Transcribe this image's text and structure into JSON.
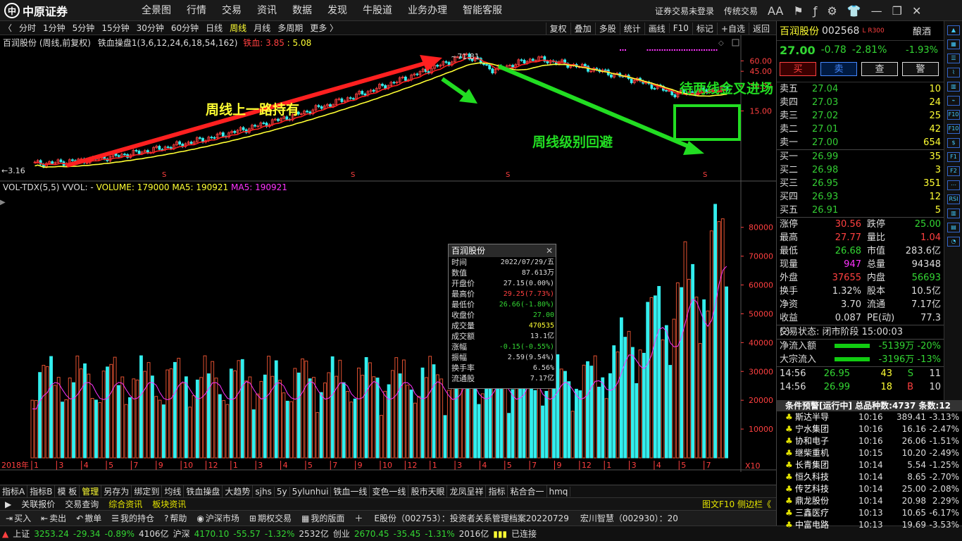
{
  "top_menu": {
    "logo_text": "中原证券",
    "logo_sub": "CENTRAL CHINA SECURITIES",
    "items": [
      "全景图",
      "行情",
      "交易",
      "资讯",
      "数据",
      "发现",
      "牛股道",
      "业务办理",
      "智能客服"
    ],
    "status": "证券交易未登录",
    "mode": "传统交易",
    "font_btn": "AA"
  },
  "period_bar": {
    "items": [
      "分时",
      "1分钟",
      "5分钟",
      "15分钟",
      "30分钟",
      "60分钟",
      "日线",
      "周线",
      "月线",
      "多周期",
      "更多 〉"
    ],
    "active": "周线",
    "right": [
      "复权",
      "叠加",
      "多股",
      "统计",
      "画线",
      "F10",
      "标记",
      "+自选",
      "返回"
    ]
  },
  "chart_info": {
    "title": "百润股份 (周线,前复权)",
    "indicator": "铁血操盘1(3,6,12,24,6,18,54,162)",
    "label_red": "铁血:",
    "val1": "3.85",
    "val2": "5.08",
    "price_high": "71.81",
    "price_low": "3.16"
  },
  "annotations": {
    "a1": "周线上一路持有",
    "a2": "周线级别回避",
    "a3": "待两线金叉进场"
  },
  "price_axis": [
    "60.00",
    "45.00",
    "30.00",
    "15.00"
  ],
  "vol_info": {
    "name": "VOL-TDX(5,5)",
    "vvol": "VVOL: -",
    "volume": "VOLUME: 179000",
    "ma5a": "MA5: 190921",
    "ma5b": "MA5: 190921"
  },
  "vol_axis": [
    "80000",
    "70000",
    "60000",
    "50000",
    "40000",
    "30000",
    "20000",
    "10000"
  ],
  "vol_unit": "X10",
  "time_axis": {
    "start": "2018年",
    "labels": [
      "1",
      "3",
      "4",
      "5",
      "7",
      "9",
      "10",
      "12",
      "1",
      "3",
      "4",
      "5",
      "7",
      "9",
      "10",
      "12",
      "1",
      "3",
      "4",
      "5",
      "7",
      "9",
      "12",
      "1",
      "3",
      "4",
      "5",
      "7"
    ],
    "period": "周线"
  },
  "popup": {
    "title": "百润股份",
    "rows": [
      {
        "l": "时间",
        "v": "2022/07/29/五",
        "c": "#ddd"
      },
      {
        "l": "数值",
        "v": "87.613万",
        "c": "#ddd"
      },
      {
        "l": "开盘价",
        "v": "27.15(0.00%)",
        "c": "#ddd"
      },
      {
        "l": "最高价",
        "v": "29.25(7.73%)",
        "c": "#ff4040"
      },
      {
        "l": "最低价",
        "v": "26.66(-1.80%)",
        "c": "#33d633"
      },
      {
        "l": "收盘价",
        "v": "27.00",
        "c": "#33d633"
      },
      {
        "l": "成交量",
        "v": "470535",
        "c": "#ffff33"
      },
      {
        "l": "成交额",
        "v": "13.1亿",
        "c": "#ddd"
      },
      {
        "l": "涨幅",
        "v": "-0.15(-0.55%)",
        "c": "#33d633"
      },
      {
        "l": "振幅",
        "v": "2.59(9.54%)",
        "c": "#ddd"
      },
      {
        "l": "换手率",
        "v": "6.56%",
        "c": "#ddd"
      },
      {
        "l": "流通股",
        "v": "7.17亿",
        "c": "#ddd"
      }
    ]
  },
  "bottom_tabs": {
    "items": [
      "指标A",
      "指标B",
      "模 板",
      "管理",
      "另存为",
      "绑定到",
      "均线",
      "铁血操盘",
      "大趋势",
      "sjhs",
      "5y",
      "5ylunhui",
      "铁血一线",
      "变色一线",
      "股市天眼",
      "龙凤呈祥",
      "指标",
      "粘合合一",
      "hmq"
    ],
    "active": "管理"
  },
  "info_bar": {
    "items": [
      "关联报价",
      "交易查询",
      "综合资讯",
      "板块资讯"
    ],
    "right": "图文F10 侧边栏《"
  },
  "tool_bar": {
    "items": [
      "买入",
      "卖出",
      "撤单",
      "我的持仓",
      "帮助",
      "沪深市场",
      "期权交易",
      "我的版面"
    ],
    "ticker": "E股份（002753）：投资者关系管理档案20220729",
    "ticker2": "宏川智慧（002930）：20"
  },
  "status_bar": {
    "sh": "上证",
    "sh_v": "3253.24",
    "sh_c": "-29.34",
    "sh_p": "-0.89%",
    "sh_a": "4106亿",
    "sz": "沪深",
    "sz_v": "4170.10",
    "sz_c": "-55.57",
    "sz_p": "-1.32%",
    "sz_a": "2532亿",
    "cy": "创业",
    "cy_v": "2670.45",
    "cy_c": "-35.45",
    "cy_p": "-1.31%",
    "cy_a": "2016亿",
    "conn": "已连接"
  },
  "stock": {
    "name": "百润股份",
    "code": "002568",
    "tags": "L R300",
    "sector": "酿酒",
    "price": "27.00",
    "chg": "-0.78",
    "pct": "-2.81%",
    "sector_pct": "-1.93%",
    "buttons": [
      "买",
      "卖",
      "查",
      "警"
    ]
  },
  "order_book": {
    "sell": [
      {
        "n": "卖五",
        "p": "27.04",
        "q": "10"
      },
      {
        "n": "卖四",
        "p": "27.03",
        "q": "24"
      },
      {
        "n": "卖三",
        "p": "27.02",
        "q": "25"
      },
      {
        "n": "卖二",
        "p": "27.01",
        "q": "42"
      },
      {
        "n": "卖一",
        "p": "27.00",
        "q": "654"
      }
    ],
    "buy": [
      {
        "n": "买一",
        "p": "26.99",
        "q": "35"
      },
      {
        "n": "买二",
        "p": "26.98",
        "q": "3"
      },
      {
        "n": "买三",
        "p": "26.95",
        "q": "351"
      },
      {
        "n": "买四",
        "p": "26.93",
        "q": "12"
      },
      {
        "n": "买五",
        "p": "26.91",
        "q": "5"
      }
    ]
  },
  "quote": [
    {
      "k": "涨停",
      "v": "30.56",
      "vc": "red",
      "k2": "跌停",
      "v2": "25.00",
      "v2c": "grn"
    },
    {
      "k": "最高",
      "v": "27.77",
      "vc": "red",
      "k2": "量比",
      "v2": "1.04",
      "v2c": "red"
    },
    {
      "k": "最低",
      "v": "26.68",
      "vc": "grn",
      "k2": "市值",
      "v2": "283.6亿",
      "v2c": "wht"
    },
    {
      "k": "现量",
      "v": "947",
      "vc": "mag",
      "k2": "总量",
      "v2": "94348",
      "v2c": "wht"
    },
    {
      "k": "外盘",
      "v": "37655",
      "vc": "red",
      "k2": "内盘",
      "v2": "56693",
      "v2c": "grn"
    },
    {
      "k": "换手",
      "v": "1.32%",
      "vc": "wht",
      "k2": "股本",
      "v2": "10.5亿",
      "v2c": "wht"
    },
    {
      "k": "净资",
      "v": "3.70",
      "vc": "wht",
      "k2": "流通",
      "v2": "7.17亿",
      "v2c": "wht"
    },
    {
      "k": "收益(-)",
      "v": "0.087",
      "vc": "wht",
      "k2": "PE(动)",
      "v2": "77.3",
      "v2c": "wht"
    }
  ],
  "trade_state": "交易状态: 闭市阶段 15:00:03",
  "flows": [
    {
      "k": "净流入额",
      "v": "-5139万 -20%"
    },
    {
      "k": "大宗流入",
      "v": "-3196万 -13%"
    }
  ],
  "ticks": [
    {
      "t": "14:56",
      "p": "26.95",
      "q": "43",
      "s": "S",
      "n": "11"
    },
    {
      "t": "14:56",
      "p": "26.99",
      "q": "18",
      "s": "B",
      "n": "10"
    }
  ],
  "alert": {
    "header": "条件预警[运行中] 总品种数:4737 条数:12",
    "rows": [
      {
        "nm": "斯达半导",
        "tm": "10:16",
        "pr": "389.41",
        "pc": "-3.13%"
      },
      {
        "nm": "宁水集团",
        "tm": "10:16",
        "pr": "16.16",
        "pc": "-2.47%"
      },
      {
        "nm": "协和电子",
        "tm": "10:16",
        "pr": "26.06",
        "pc": "-1.51%"
      },
      {
        "nm": "继柴重机",
        "tm": "10:15",
        "pr": "10.20",
        "pc": "-2.49%"
      },
      {
        "nm": "长青集团",
        "tm": "10:14",
        "pr": "5.54",
        "pc": "-1.25%"
      },
      {
        "nm": "恒久科技",
        "tm": "10:14",
        "pr": "8.65",
        "pc": "-2.70%"
      },
      {
        "nm": "传艺科技",
        "tm": "10:14",
        "pr": "25.00",
        "pc": "-2.08%"
      },
      {
        "nm": "鼎龙股份",
        "tm": "10:14",
        "pr": "20.98",
        "pc": "2.29%"
      },
      {
        "nm": "三鑫医疗",
        "tm": "10:13",
        "pr": "10.65",
        "pc": "-6.17%"
      },
      {
        "nm": "中富电路",
        "tm": "10:13",
        "pr": "19.69",
        "pc": "-3.53%"
      }
    ]
  },
  "colors": {
    "up": "#ff4040",
    "down": "#33d633",
    "accent": "#ffff33",
    "cyan": "#3ee"
  }
}
